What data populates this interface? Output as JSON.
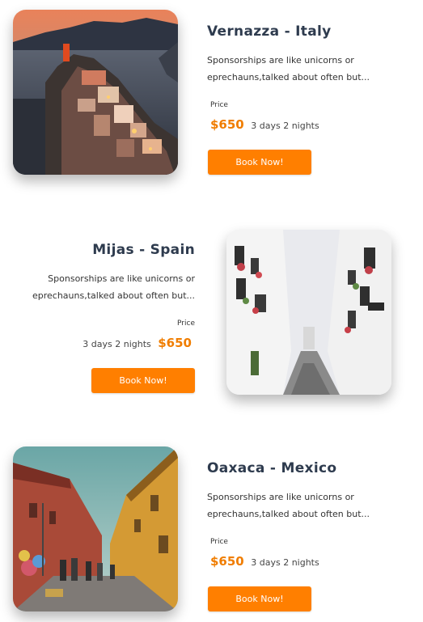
{
  "tours": [
    {
      "title": "Vernazza - Italy",
      "description": "Sponsorships are like unicorns or eprechauns,talked about often but...",
      "price_label": "Price",
      "price": "$650",
      "duration": "3 days 2 nights",
      "button": "Book Now!",
      "image_icon": "coastal-village-photo"
    },
    {
      "title": "Mijas - Spain",
      "description": "Sponsorships are like unicorns or eprechauns,talked about often but...",
      "price_label": "Price",
      "price": "$650",
      "duration": "3 days 2 nights",
      "button": "Book Now!",
      "image_icon": "white-street-photo"
    },
    {
      "title": "Oaxaca - Mexico",
      "description": "Sponsorships are like unicorns or eprechauns,talked about often but...",
      "price_label": "Price",
      "price": "$650",
      "duration": "3 days 2 nights",
      "button": "Book Now!",
      "image_icon": "colorful-street-photo"
    }
  ],
  "colors": {
    "accent": "#ff7f00",
    "price": "#f07d00",
    "title": "#2e3b4e"
  }
}
